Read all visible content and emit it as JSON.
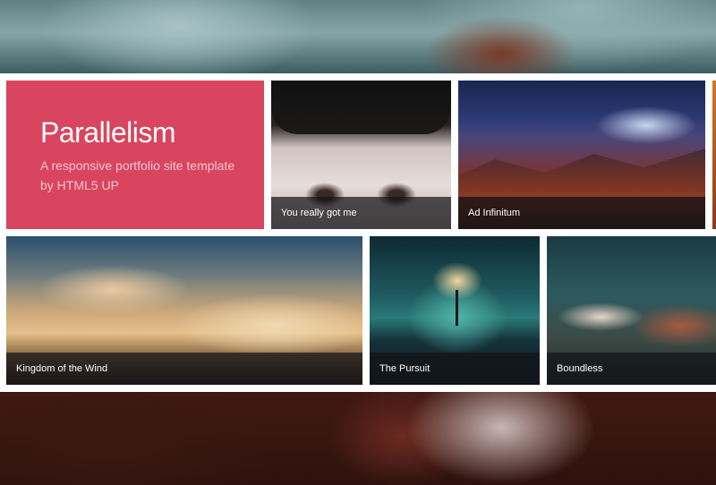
{
  "intro": {
    "title": "Parallelism",
    "subtitle": "A responsive portfolio site template by HTML5 UP"
  },
  "tiles": [
    {
      "caption": "You really got me"
    },
    {
      "caption": "Ad Infinitum"
    },
    {
      "caption": "Kingdom of the Wind"
    },
    {
      "caption": "The Pursuit"
    },
    {
      "caption": "Boundless"
    }
  ],
  "colors": {
    "intro_background": "#d9445e",
    "band_background": "#ffffff",
    "caption_background": "rgba(20,20,24,0.72)"
  }
}
